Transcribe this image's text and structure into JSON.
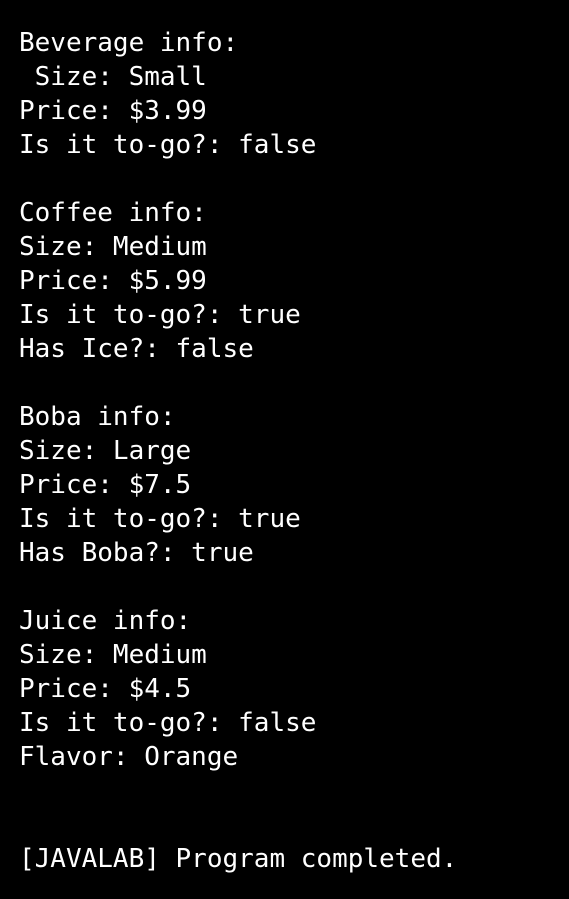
{
  "terminal": {
    "lines": [
      "Beverage info:",
      " Size: Small",
      "Price: $3.99",
      "Is it to-go?: false",
      "",
      "Coffee info:",
      "Size: Medium",
      "Price: $5.99",
      "Is it to-go?: true",
      "Has Ice?: false",
      "",
      "Boba info:",
      "Size: Large",
      "Price: $7.5",
      "Is it to-go?: true",
      "Has Boba?: true",
      "",
      "Juice info:",
      "Size: Medium",
      "Price: $4.5",
      "Is it to-go?: false",
      "Flavor: Orange",
      "",
      "",
      "[JAVALAB] Program completed."
    ]
  },
  "colors": {
    "background": "#000000",
    "text": "#ffffff"
  }
}
